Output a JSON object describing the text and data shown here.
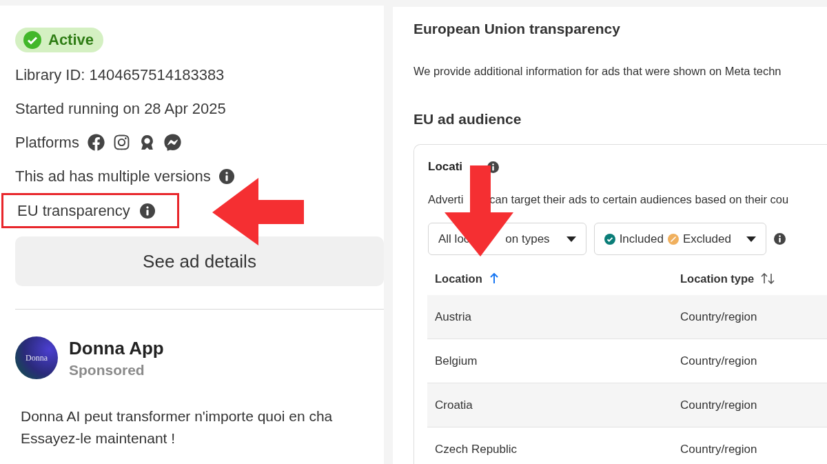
{
  "ad_summary": {
    "status": {
      "label": "Active",
      "active": true
    },
    "library_id": "Library ID: 1404657514183383",
    "started": "Started running on 28 Apr 2025",
    "platforms": "Platforms",
    "versions": "This ad has multiple versions",
    "eu_transparency": {
      "label": "EU transparency",
      "highlighted": true
    },
    "details_button": "See ad details"
  },
  "ad_preview": {
    "avatar_text": "Donna",
    "advertiser": "Donna App",
    "sponsored": "Sponsored",
    "body": [
      "Donna AI peut transformer n'importe quoi en cha",
      "Essayez-le maintenant !"
    ]
  },
  "eu_panel": {
    "title": "European Union transparency",
    "intro": "We provide additional information for ads that were shown on Meta techn",
    "audience_title": "EU ad audience",
    "card": {
      "title": "Locati",
      "description": [
        "Adverti",
        "can target their ads to certain audiences based on their cou"
      ],
      "filters": [
        {
          "kind": "type",
          "parts": [
            "All loc",
            "on types"
          ]
        },
        {
          "kind": "status",
          "included": "Included",
          "excluded": "Excluded"
        }
      ],
      "table": {
        "columns": [
          {
            "label": "Location",
            "sorted": true
          },
          {
            "label": "Location type",
            "sorted": false
          }
        ],
        "rows": [
          {
            "cells": [
              "Austria",
              "Country/region"
            ]
          },
          {
            "cells": [
              "Belgium",
              "Country/region"
            ]
          },
          {
            "cells": [
              "Croatia",
              "Country/region"
            ]
          },
          {
            "cells": [
              "Czech Republic",
              "Country/region"
            ]
          }
        ]
      }
    }
  }
}
